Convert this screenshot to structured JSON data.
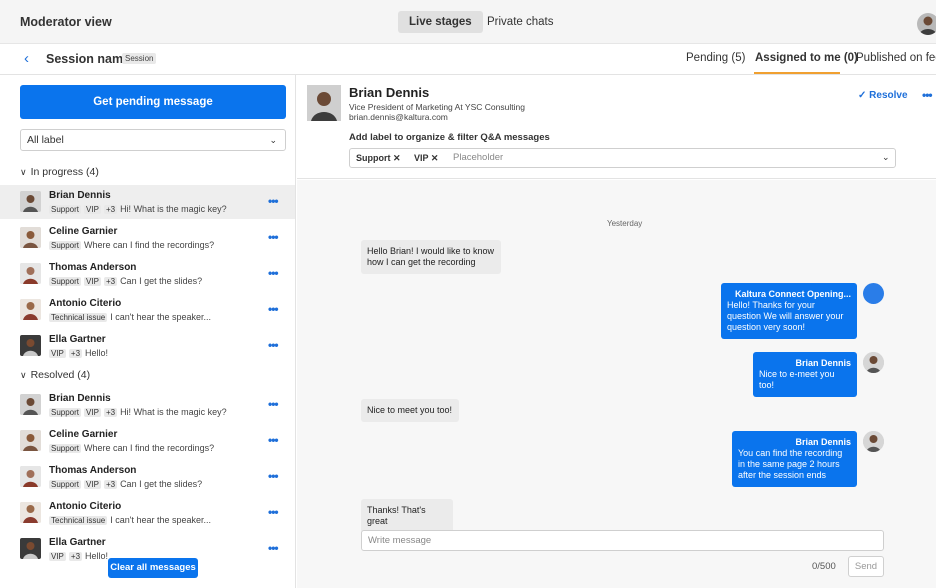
{
  "topbar": {
    "title": "Moderator view",
    "tabs": [
      "Live stages",
      "Private chats"
    ]
  },
  "session": {
    "back_icon": "chevron-left-icon",
    "name": "Session name",
    "badge": "Session",
    "tabs": [
      "Pending (5)",
      "Assigned to me (0)",
      "Published on feed"
    ]
  },
  "left": {
    "get_button": "Get pending message",
    "label_select": "All label",
    "in_progress_header": "In progress (4)",
    "resolved_header": "Resolved (4)",
    "in_progress": [
      {
        "name": "Brian Dennis",
        "tags": [
          "Support",
          "VIP"
        ],
        "extra": "+3",
        "message": "Hi! What is the magic key?"
      },
      {
        "name": "Celine Garnier",
        "tags": [
          "Support"
        ],
        "extra": "",
        "message": "Where can I find the recordings?"
      },
      {
        "name": "Thomas Anderson",
        "tags": [
          "Support",
          "VIP"
        ],
        "extra": "+3",
        "message": "Can I get the slides?"
      },
      {
        "name": "Antonio Citerio",
        "tags": [
          "Technical issue"
        ],
        "extra": "",
        "message": "I can't hear the speaker..."
      },
      {
        "name": "Ella Gartner",
        "tags": [
          "VIP"
        ],
        "extra": "+3",
        "message": "Hello!"
      }
    ],
    "resolved": [
      {
        "name": "Brian Dennis",
        "tags": [
          "Support",
          "VIP"
        ],
        "extra": "+3",
        "message": "Hi! What is the magic key?"
      },
      {
        "name": "Celine Garnier",
        "tags": [
          "Support"
        ],
        "extra": "",
        "message": "Where can I find the recordings?"
      },
      {
        "name": "Thomas Anderson",
        "tags": [
          "Support",
          "VIP"
        ],
        "extra": "+3",
        "message": "Can I get the slides?"
      },
      {
        "name": "Antonio Citerio",
        "tags": [
          "Technical issue"
        ],
        "extra": "",
        "message": "I can't hear the speaker..."
      },
      {
        "name": "Ella Gartner",
        "tags": [
          "VIP"
        ],
        "extra": "+3",
        "message": "Hello!"
      }
    ],
    "more_label": "•••",
    "clear_button": "Clear all messages"
  },
  "user": {
    "name": "Brian Dennis",
    "title": "Vice President of Marketing At YSC Consulting",
    "email": "brian.dennis@kaltura.com",
    "resolve": "✓ Resolve",
    "more": "•••",
    "add_label_text": "Add label to organize & filter Q&A messages",
    "chips": [
      "Support ✕",
      "VIP ✕"
    ],
    "placeholder": "Placeholder"
  },
  "chat": {
    "day": "Yesterday",
    "messages": [
      {
        "dir": "in",
        "text": "Hello Brian! I would like to know how I can get the recording"
      },
      {
        "dir": "out",
        "sender": "Kaltura Connect Opening...",
        "text": "Hello! Thanks for your question We will answer your question very soon!"
      },
      {
        "dir": "out",
        "sender": "Brian Dennis",
        "text": "Nice to e-meet you too!"
      },
      {
        "dir": "in",
        "text": "Nice to meet you too!"
      },
      {
        "dir": "out",
        "sender": "Brian Dennis",
        "text": "You can find the recording in the same page 2 hours after the session ends"
      },
      {
        "dir": "in",
        "text": "Thanks! That's great"
      }
    ],
    "write_placeholder": "Write message",
    "counter": "0/500",
    "send": "Send"
  },
  "colors": {
    "accent": "#0a74ed",
    "tab_underline": "#f0a030"
  }
}
